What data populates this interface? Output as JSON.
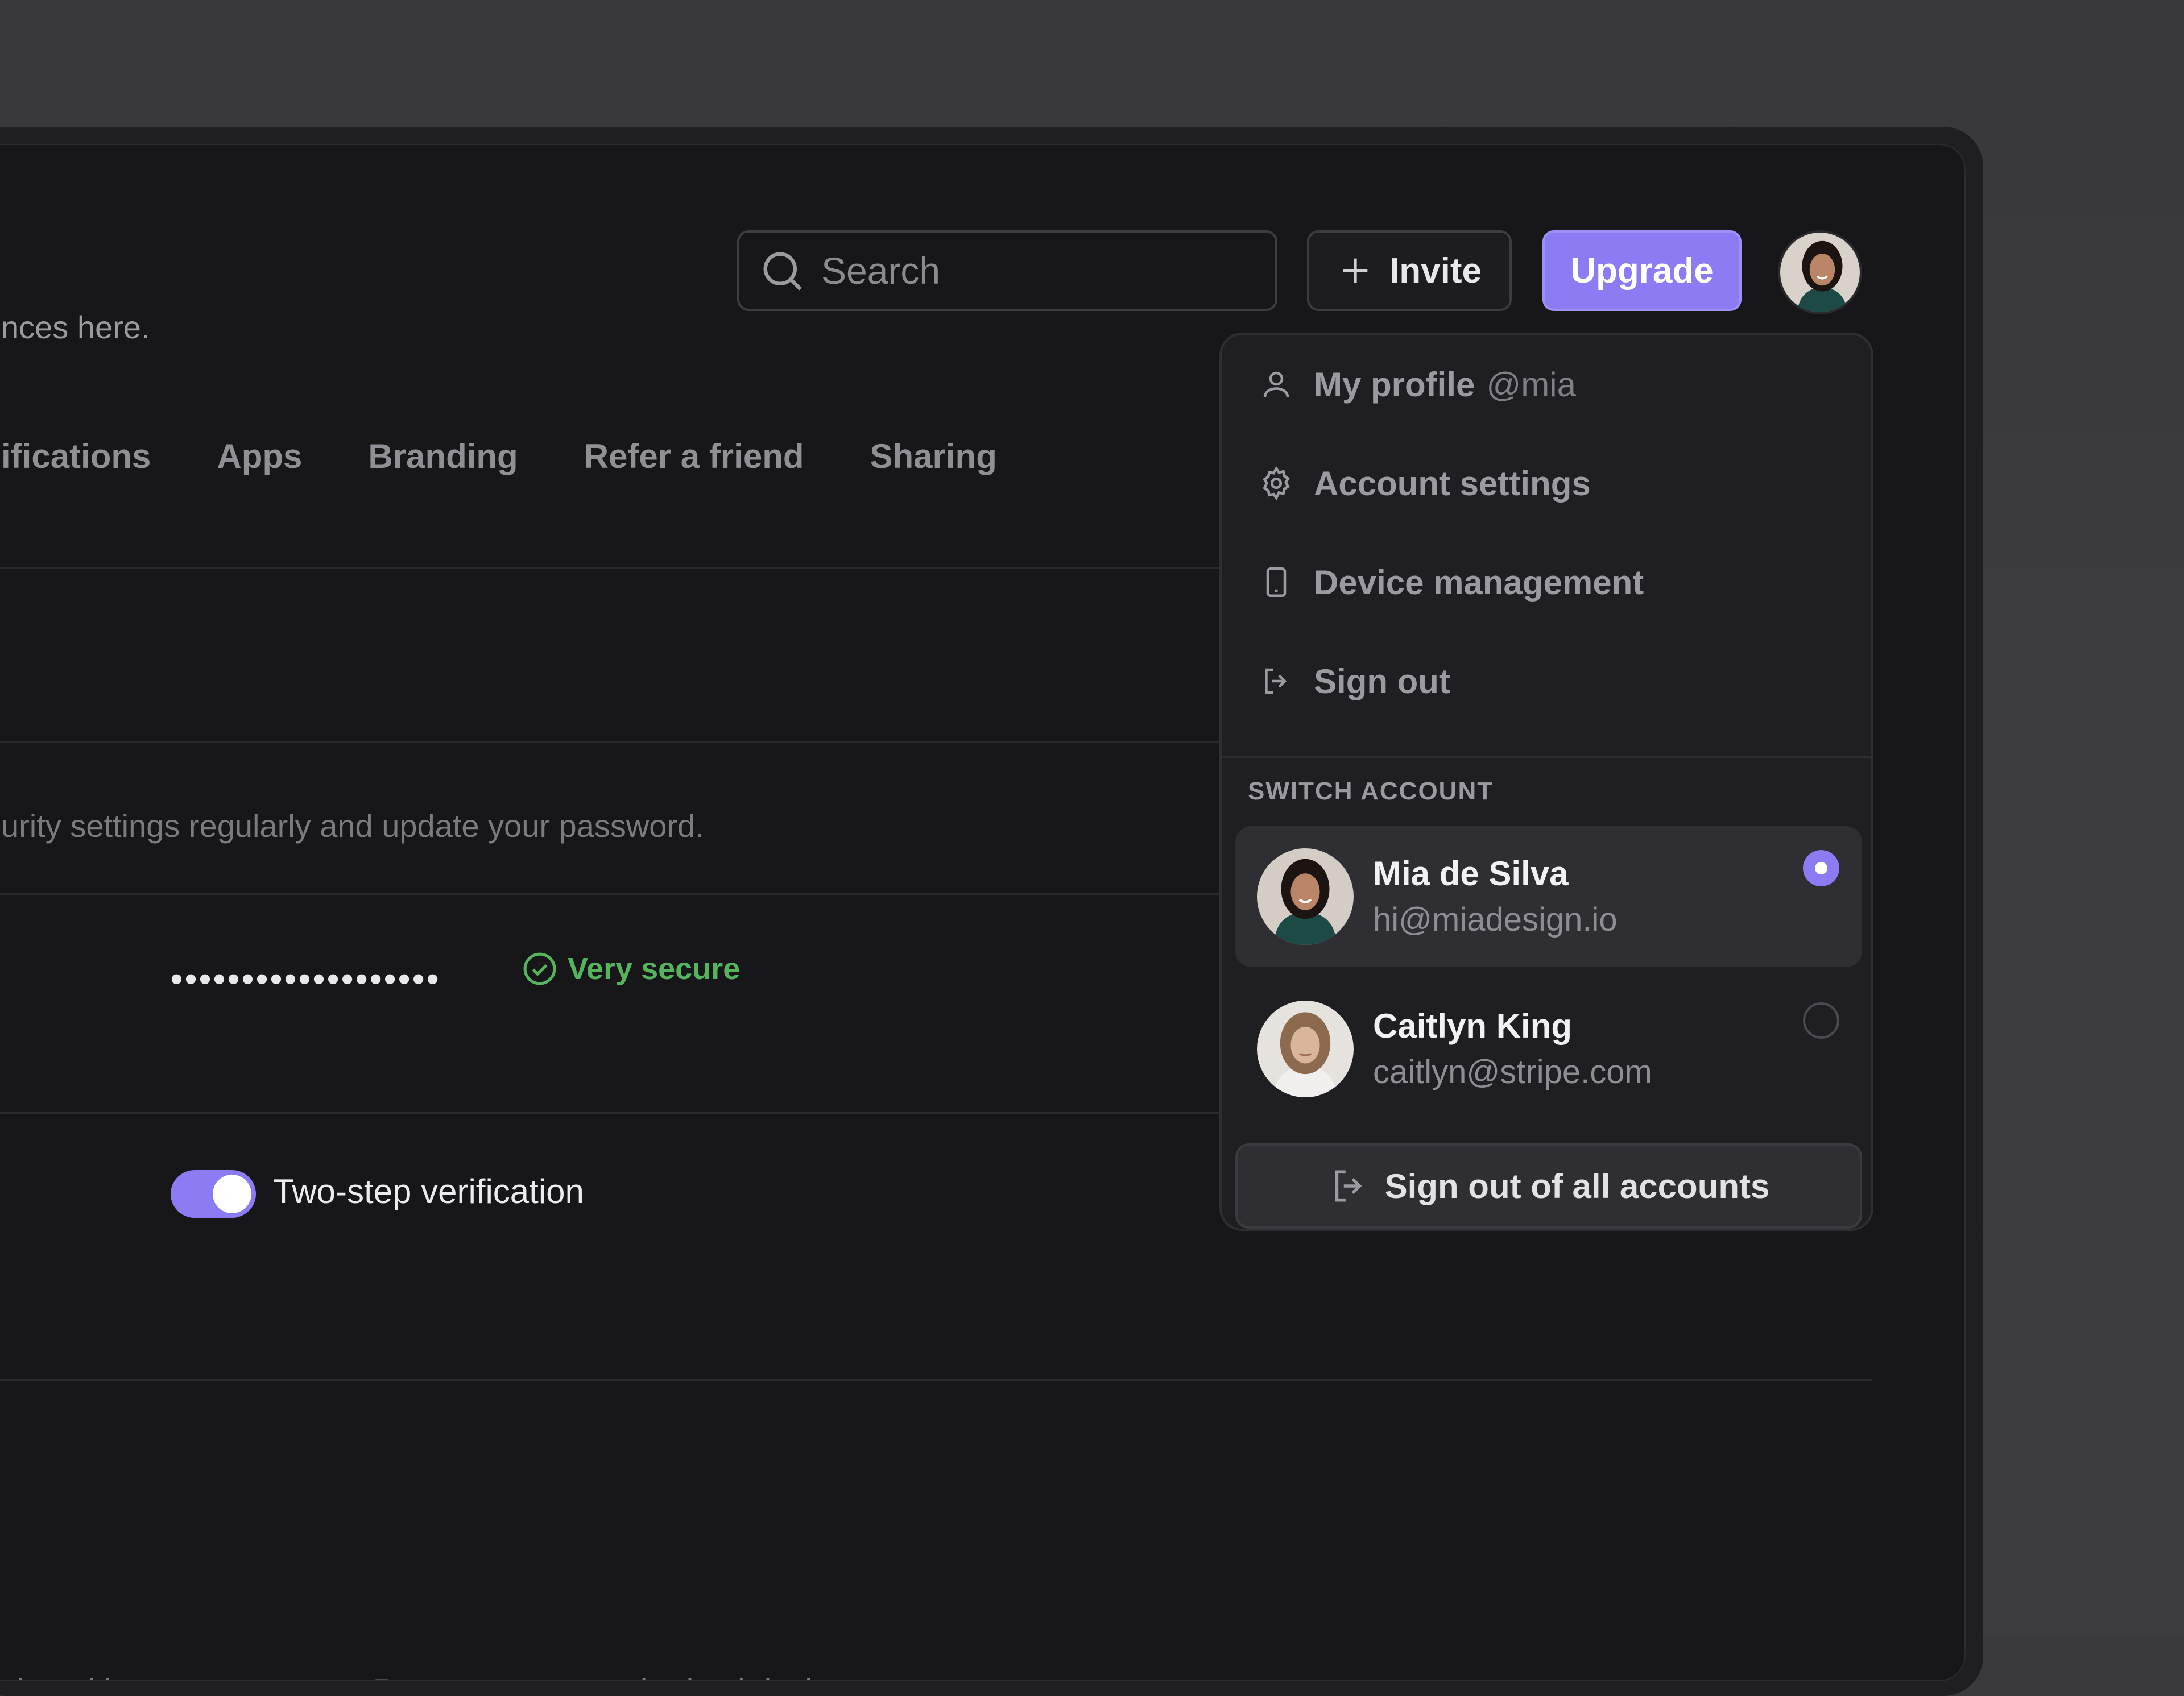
{
  "header": {
    "search_placeholder": "Search",
    "invite_label": "Invite",
    "upgrade_label": "Upgrade"
  },
  "page": {
    "subtitle_fragment": "nces here.",
    "tabs": [
      "ifications",
      "Apps",
      "Branding",
      "Refer a friend",
      "Sharing"
    ],
    "security_desc": "urity settings regularly and update your password.",
    "password_mask": "•••••••••••••••••••",
    "password_strength": "Very secure",
    "two_step_label": "Two-step verification",
    "two_step_enabled": true,
    "devices_desc": "signed in to your account. Remove any unauthorized devices."
  },
  "dropdown": {
    "items": [
      {
        "label": "My profile",
        "sub": "@mia",
        "icon": "user-icon"
      },
      {
        "label": "Account settings",
        "icon": "gear-icon"
      },
      {
        "label": "Device management",
        "icon": "phone-icon"
      },
      {
        "label": "Sign out",
        "icon": "sign-out-icon"
      }
    ],
    "switch_title": "SWITCH ACCOUNT",
    "accounts": [
      {
        "name": "Mia de Silva",
        "email": "hi@miadesign.io",
        "selected": true
      },
      {
        "name": "Caitlyn King",
        "email": "caitlyn@stripe.com",
        "selected": false
      }
    ],
    "sign_out_all": "Sign out of all accounts"
  },
  "colors": {
    "accent": "#8b7cf4",
    "success": "#56b45f",
    "background": "#17171a"
  }
}
